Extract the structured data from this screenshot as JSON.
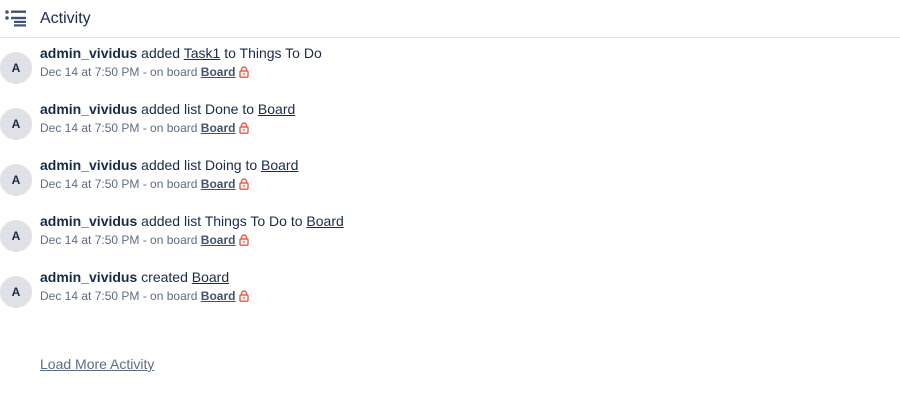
{
  "header": {
    "title": "Activity",
    "icon": "activity-list-icon"
  },
  "entries": [
    {
      "avatar": "A",
      "member": "admin_vividus",
      "action": "added",
      "target": "Task1",
      "connector": "to Things To Do",
      "meta": "Dec 14 at 7:50 PM - on board",
      "board": "Board"
    },
    {
      "avatar": "A",
      "member": "admin_vividus",
      "action": "added list Done to",
      "target": "Board",
      "connector": "",
      "meta": "Dec 14 at 7:50 PM - on board",
      "board": "Board"
    },
    {
      "avatar": "A",
      "member": "admin_vividus",
      "action": "added list Doing to",
      "target": "Board",
      "connector": "",
      "meta": "Dec 14 at 7:50 PM - on board",
      "board": "Board"
    },
    {
      "avatar": "A",
      "member": "admin_vividus",
      "action": "added list Things To Do to",
      "target": "Board",
      "connector": "",
      "meta": "Dec 14 at 7:50 PM - on board",
      "board": "Board"
    },
    {
      "avatar": "A",
      "member": "admin_vividus",
      "action": "created",
      "target": "Board",
      "connector": "",
      "meta": "Dec 14 at 7:50 PM - on board",
      "board": "Board"
    }
  ],
  "load_more_label": "Load More Activity",
  "colors": {
    "text": "#172b4d",
    "meta": "#5e6c84",
    "avatar_bg": "#dfe1e6",
    "lock": "#eb5a46"
  }
}
